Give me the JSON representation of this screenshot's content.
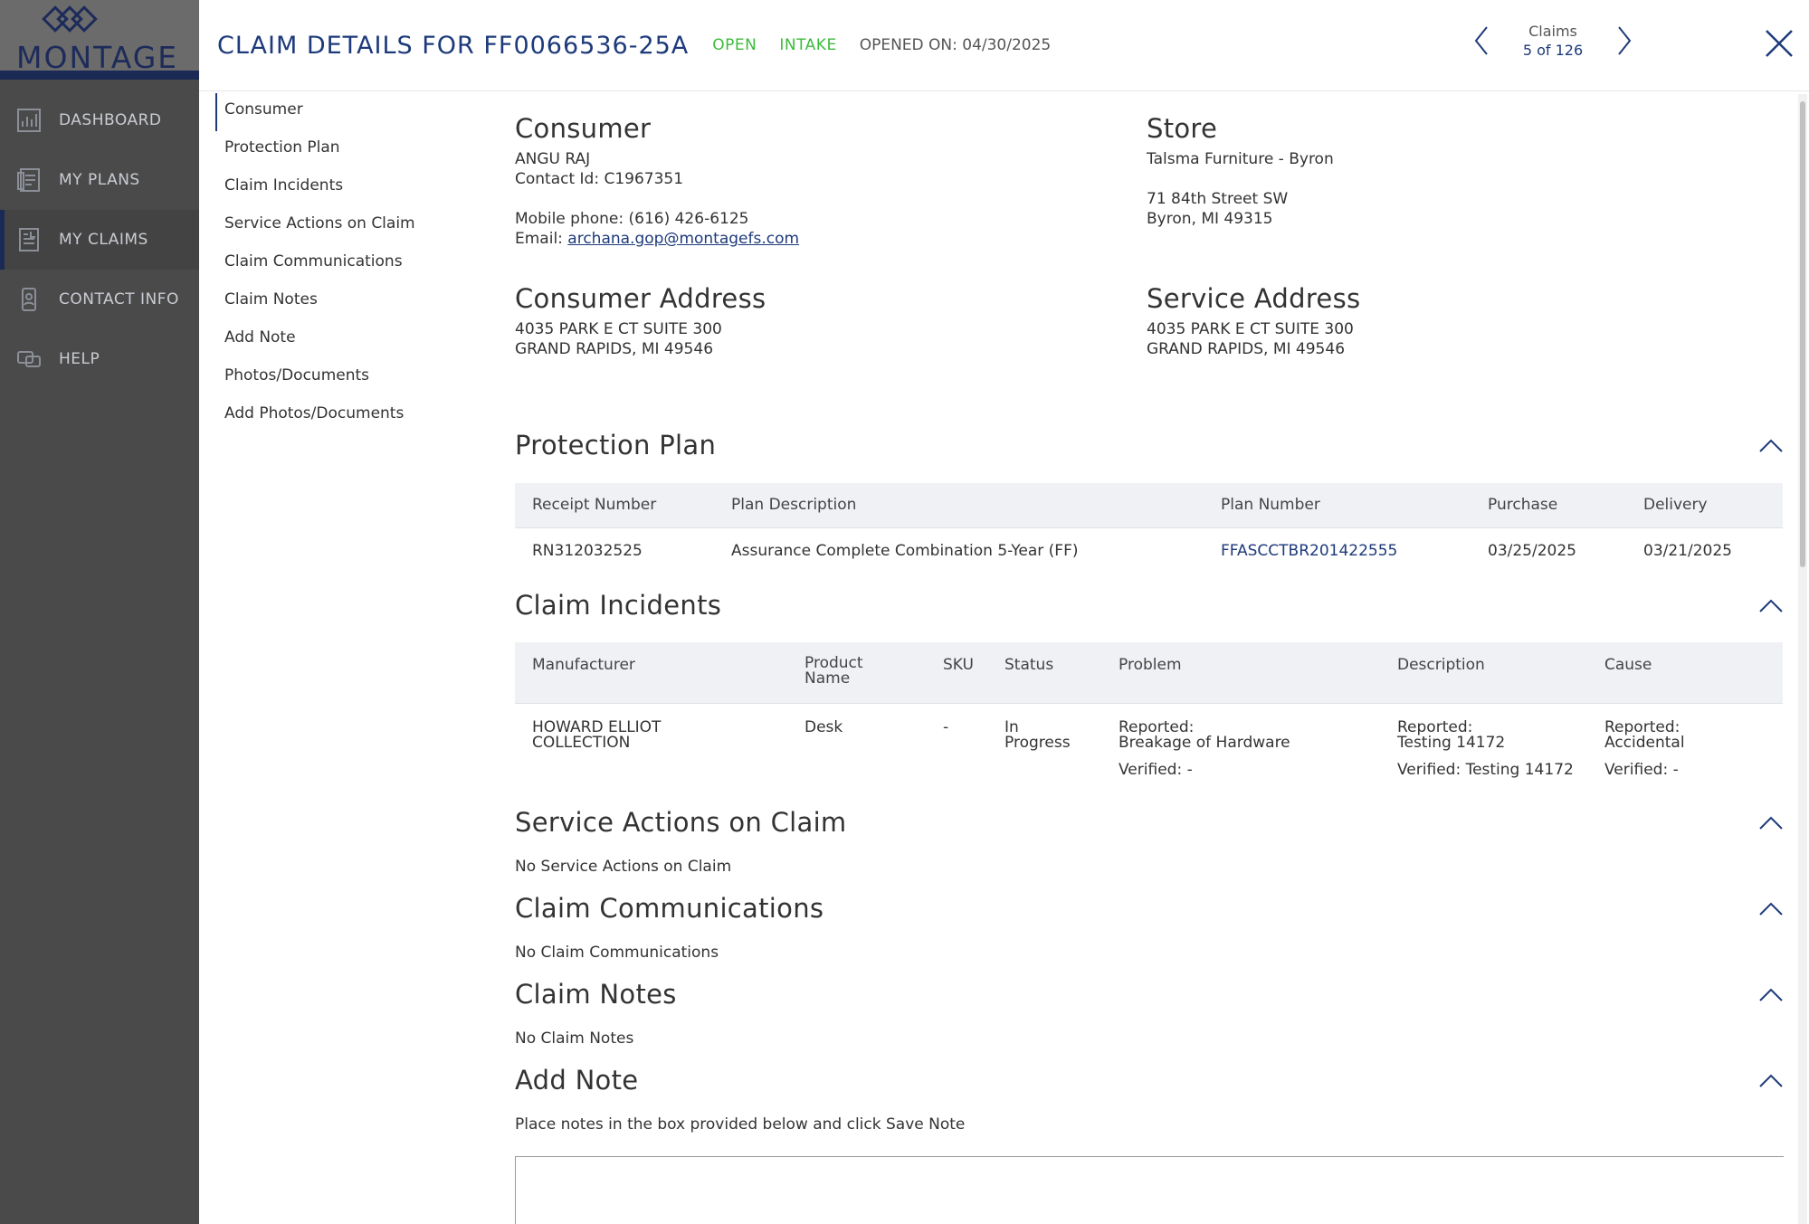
{
  "sidebar": {
    "logo_text": "MONTAGE",
    "items": [
      {
        "label": "DASHBOARD",
        "icon": "dashboard-icon"
      },
      {
        "label": "MY PLANS",
        "icon": "plans-icon"
      },
      {
        "label": "MY CLAIMS",
        "icon": "claims-icon"
      },
      {
        "label": "CONTACT INFO",
        "icon": "contact-icon"
      },
      {
        "label": "HELP",
        "icon": "help-icon"
      }
    ],
    "active_index": 2
  },
  "header": {
    "title": "CLAIM DETAILS FOR FF0066536-25A",
    "status_open": "OPEN",
    "status_stage": "INTAKE",
    "opened_on": "OPENED ON: 04/30/2025",
    "pager_label": "Claims",
    "pager_count": "5 of 126"
  },
  "section_nav": [
    "Consumer",
    "Protection Plan",
    "Claim Incidents",
    "Service Actions on Claim",
    "Claim Communications",
    "Claim Notes",
    "Add Note",
    "Photos/Documents",
    "Add Photos/Documents"
  ],
  "consumer": {
    "heading": "Consumer",
    "name": "ANGU RAJ",
    "contact_id": "Contact Id: C1967351",
    "mobile": "Mobile phone: (616) 426-6125",
    "email_label": "Email: ",
    "email": "archana.gop@montagefs.com"
  },
  "store": {
    "heading": "Store",
    "name": "Talsma Furniture - Byron",
    "address1": "71 84th Street SW",
    "address2": "Byron, MI 49315"
  },
  "consumer_address": {
    "heading": "Consumer Address",
    "line1": "4035 PARK E CT SUITE 300",
    "line2": "GRAND RAPIDS, MI 49546"
  },
  "service_address": {
    "heading": "Service Address",
    "line1": "4035 PARK E CT SUITE 300",
    "line2": "GRAND RAPIDS, MI 49546"
  },
  "protection_plan": {
    "heading": "Protection Plan",
    "columns": [
      "Receipt Number",
      "Plan Description",
      "Plan Number",
      "Purchase",
      "Delivery"
    ],
    "row": {
      "receipt": "RN312032525",
      "description": "Assurance Complete Combination 5-Year (FF)",
      "plan_number": "FFASCCTBR201422555",
      "purchase": "03/25/2025",
      "delivery": "03/21/2025"
    }
  },
  "claim_incidents": {
    "heading": "Claim Incidents",
    "columns": {
      "manufacturer": "Manufacturer",
      "product_1": "Product",
      "product_2": "Name",
      "sku": "SKU",
      "status": "Status",
      "problem": "Problem",
      "description": "Description",
      "cause": "Cause"
    },
    "row": {
      "manufacturer_1": "HOWARD ELLIOT",
      "manufacturer_2": "COLLECTION",
      "product": "Desk",
      "sku": "-",
      "status_1": "In",
      "status_2": "Progress",
      "problem_reported_label": "Reported:",
      "problem_reported": "Breakage of Hardware",
      "problem_verified": "Verified: -",
      "description_reported_label": "Reported:",
      "description_reported": "Testing 14172",
      "description_verified": "Verified: Testing 14172",
      "cause_reported_label": "Reported:",
      "cause_reported": "Accidental",
      "cause_verified": "Verified: -"
    }
  },
  "service_actions": {
    "heading": "Service Actions on Claim",
    "empty": "No Service Actions on Claim"
  },
  "claim_communications": {
    "heading": "Claim Communications",
    "empty": "No Claim Communications"
  },
  "claim_notes": {
    "heading": "Claim Notes",
    "empty": "No Claim Notes"
  },
  "add_note": {
    "heading": "Add Note",
    "instructions": "Place notes in the box provided below and click Save Note"
  },
  "colors": {
    "brand_navy": "#1d3a7a",
    "status_green": "#3dbb3d",
    "sidebar_bg": "#4a4a4a"
  }
}
